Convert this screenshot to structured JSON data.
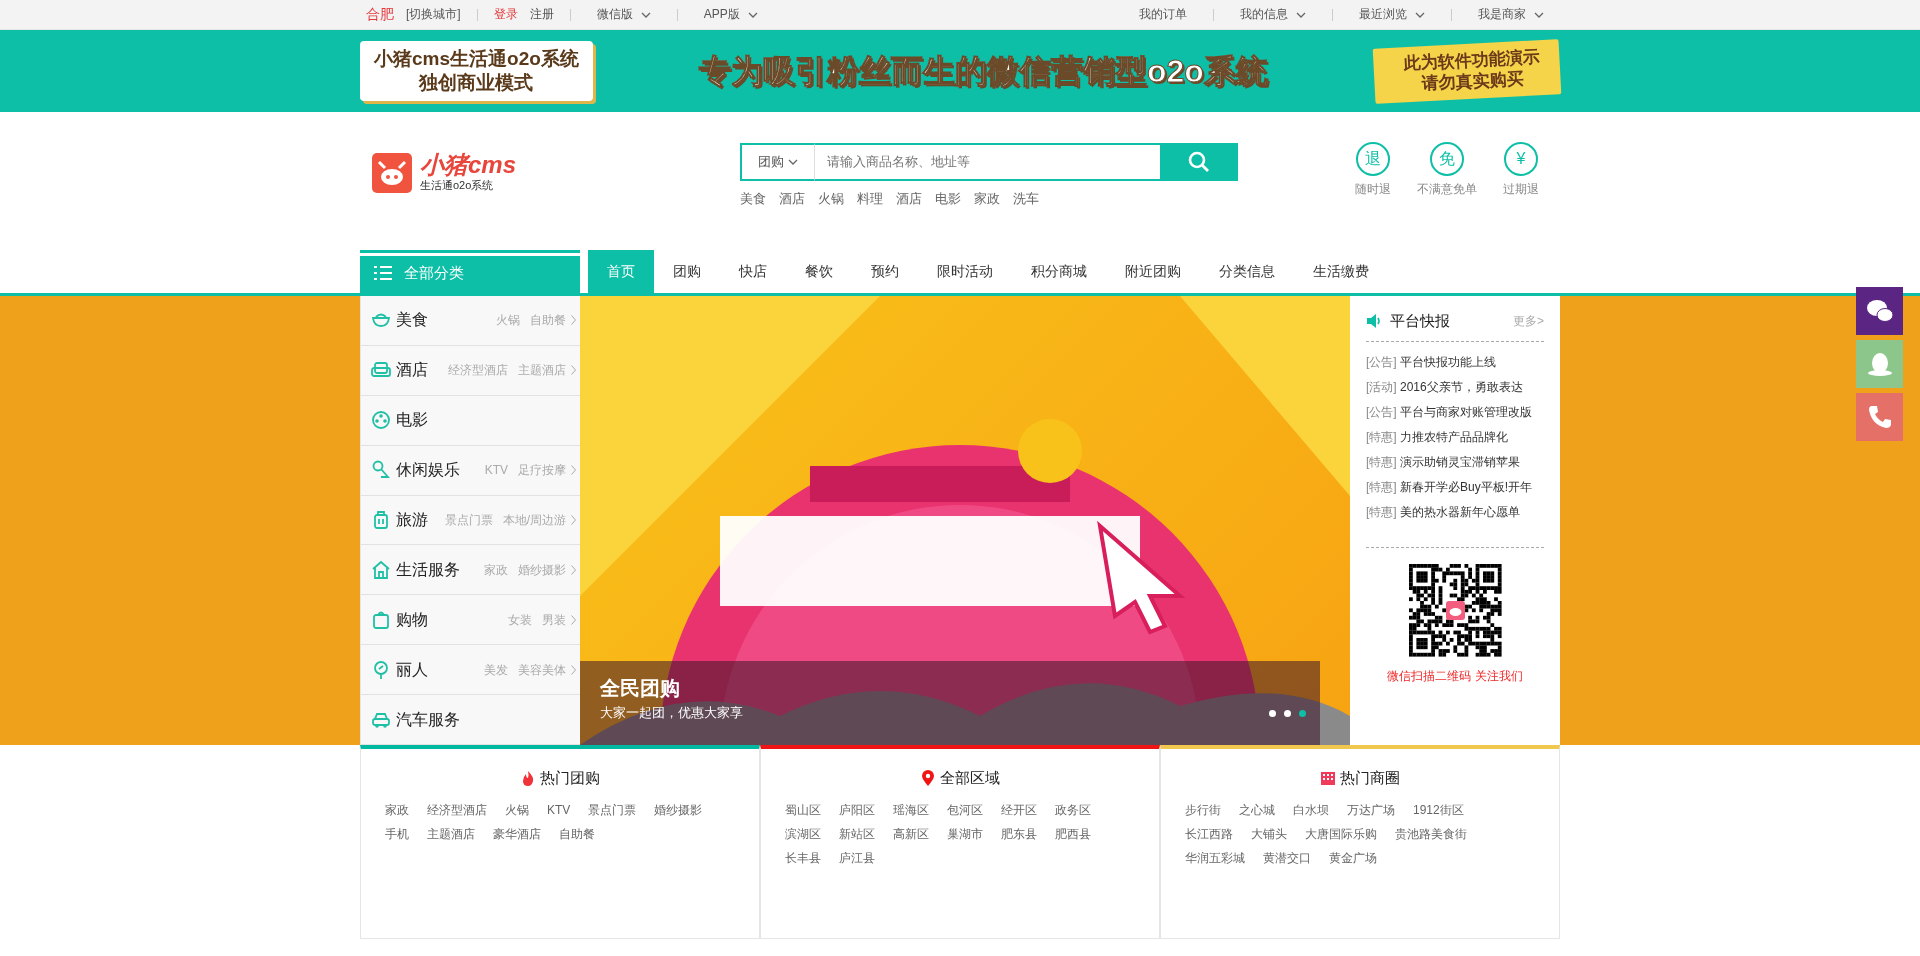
{
  "top_bar": {
    "city": "合肥",
    "switch_city": "[切换城市]",
    "login": "登录",
    "register": "注册",
    "left_menus": [
      {
        "label": "微信版",
        "dropdown": true
      },
      {
        "label": "APP版",
        "dropdown": true
      }
    ],
    "right_menus": [
      {
        "label": "我的订单",
        "dropdown": false
      },
      {
        "label": "我的信息",
        "dropdown": true
      },
      {
        "label": "最近浏览",
        "dropdown": true
      },
      {
        "label": "我是商家",
        "dropdown": true
      }
    ]
  },
  "ad_banner": {
    "badge_lines": [
      "小猪cms生活通o2o系统",
      "独创商业模式"
    ],
    "slogan": "专为吸引粉丝而生的微信营销型o2o系统",
    "note_lines": [
      "此为软件功能演示",
      "请勿真实购买"
    ]
  },
  "header": {
    "logo_name": "小猪cms",
    "logo_tagline": "生活通o2o系统",
    "search": {
      "category": "团购",
      "placeholder": "请输入商品名称、地址等"
    },
    "hot_keywords": [
      "美食",
      "酒店",
      "火锅",
      "料理",
      "酒店",
      "电影",
      "家政",
      "洗车"
    ],
    "guarantees": [
      {
        "symbol": "退",
        "label": "随时退"
      },
      {
        "symbol": "免",
        "label": "不满意免单"
      },
      {
        "symbol": "¥",
        "label": "过期退"
      }
    ]
  },
  "category_header": "全部分类",
  "nav": [
    {
      "label": "首页",
      "selected": true
    },
    {
      "label": "团购",
      "selected": false
    },
    {
      "label": "快店",
      "selected": false
    },
    {
      "label": "餐饮",
      "selected": false
    },
    {
      "label": "预约",
      "selected": false
    },
    {
      "label": "限时活动",
      "selected": false
    },
    {
      "label": "积分商城",
      "selected": false
    },
    {
      "label": "附近团购",
      "selected": false
    },
    {
      "label": "分类信息",
      "selected": false
    },
    {
      "label": "生活缴费",
      "selected": false
    }
  ],
  "categories": [
    {
      "kind": "bowl",
      "name": "美食",
      "tags": [
        "火锅",
        "自助餐"
      ]
    },
    {
      "kind": "sofa",
      "name": "酒店",
      "tags": [
        "经济型酒店",
        "主题酒店"
      ]
    },
    {
      "kind": "film",
      "name": "电影"
    },
    {
      "kind": "mic",
      "name": "休闲娱乐",
      "tags": [
        "KTV",
        "足疗按摩"
      ]
    },
    {
      "kind": "luggage",
      "name": "旅游",
      "tags": [
        "景点门票",
        "本地/周边游"
      ]
    },
    {
      "kind": "house",
      "name": "生活服务",
      "tags": [
        "家政",
        "婚纱摄影"
      ]
    },
    {
      "kind": "bag",
      "name": "购物",
      "tags": [
        "女装",
        "男装"
      ]
    },
    {
      "kind": "mirror",
      "name": "丽人",
      "tags": [
        "美发",
        "美容美体"
      ]
    },
    {
      "kind": "car",
      "name": "汽车服务"
    }
  ],
  "slider": {
    "caption_title": "全民团购",
    "caption_text": "大家一起团，优惠大家享",
    "dots": [
      {
        "selected": false
      },
      {
        "selected": false
      },
      {
        "selected": true
      }
    ]
  },
  "news": {
    "title": "平台快报",
    "more": "更多>",
    "items": [
      {
        "tag": "[公告]",
        "text": "平台快报功能上线"
      },
      {
        "tag": "[活动]",
        "text": "2016父亲节，勇敢表达"
      },
      {
        "tag": "[公告]",
        "text": "平台与商家对账管理改版"
      },
      {
        "tag": "[特惠]",
        "text": "力推农特产品品牌化"
      },
      {
        "tag": "[特惠]",
        "text": "演示助销灵宝滞销苹果"
      },
      {
        "tag": "[特惠]",
        "text": "新春开学必Buy平板!开年"
      },
      {
        "tag": "[特惠]",
        "text": "美的热水器新年心愿单"
      }
    ],
    "qr_caption": "微信扫描二维码 关注我们"
  },
  "bottom_panels": [
    {
      "kind": "fire",
      "color": "#00b9a0",
      "title": "热门团购",
      "links": [
        "家政",
        "经济型酒店",
        "火锅",
        "KTV",
        "景点门票",
        "婚纱摄影",
        "手机",
        "主题酒店",
        "豪华酒店",
        "自助餐"
      ]
    },
    {
      "kind": "pin",
      "color": "#f01414",
      "title": "全部区域",
      "links": [
        "蜀山区",
        "庐阳区",
        "瑶海区",
        "包河区",
        "经开区",
        "政务区",
        "滨湖区",
        "新站区",
        "高新区",
        "巢湖市",
        "肥东县",
        "肥西县",
        "长丰县",
        "庐江县"
      ]
    },
    {
      "kind": "building",
      "color": "#f0c850",
      "title": "热门商圈",
      "links": [
        "步行街",
        "之心城",
        "白水坝",
        "万达广场",
        "1912街区",
        "长江西路",
        "大铺头",
        "大唐国际乐购",
        "贵池路美食街",
        "华润五彩城",
        "黄潜交口",
        "黄金广场"
      ]
    }
  ],
  "side_buttons": [
    {
      "kind": "wechat",
      "color": "#5a2583"
    },
    {
      "kind": "qq",
      "color": "#8cc68a"
    },
    {
      "kind": "phone",
      "color": "#e57068"
    }
  ]
}
